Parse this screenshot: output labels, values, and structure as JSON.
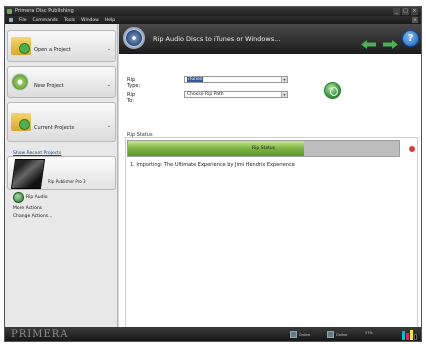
{
  "window": {
    "title": "Primera Disc Publishing"
  },
  "menu": {
    "items": [
      "File",
      "Commands",
      "Tools",
      "Window",
      "Help"
    ]
  },
  "sidebar": {
    "panels": [
      {
        "label": "Open a Project",
        "icon": "folder-open-icon"
      },
      {
        "label": "New Project",
        "icon": "disc-icon"
      },
      {
        "label": "Current Projects",
        "icon": "folder-icon"
      }
    ],
    "recent_link": "Show Recent Projects",
    "photo_caption": "Rip Publisher Pro 3",
    "actions": {
      "rip": "Rip Audio",
      "more": "More Actions",
      "change": "Change Actions..."
    }
  },
  "main": {
    "title": "Rip Audio Discs to iTunes or Windows...",
    "rip_type_label": "Rip Type:",
    "rip_type_value": "iTunes",
    "rip_to_label": "Rip To:",
    "rip_to_value": "Choose Rip Path",
    "status_heading": "Rip Status",
    "progress_text": "Rip Status",
    "progress_fraction": 0.65,
    "track_line": "1. Importing: The Ultimate Experience by Jimi Hendrix Experience"
  },
  "bottom": {
    "logo": "PRIMERA",
    "status_1": "Online",
    "status_2": "Online",
    "ink_label": "57%"
  },
  "colors": {
    "progress_green": "#7cb342",
    "nav_green": "#4caf50",
    "help_blue": "#1565c0",
    "stop_red": "#e53935"
  }
}
